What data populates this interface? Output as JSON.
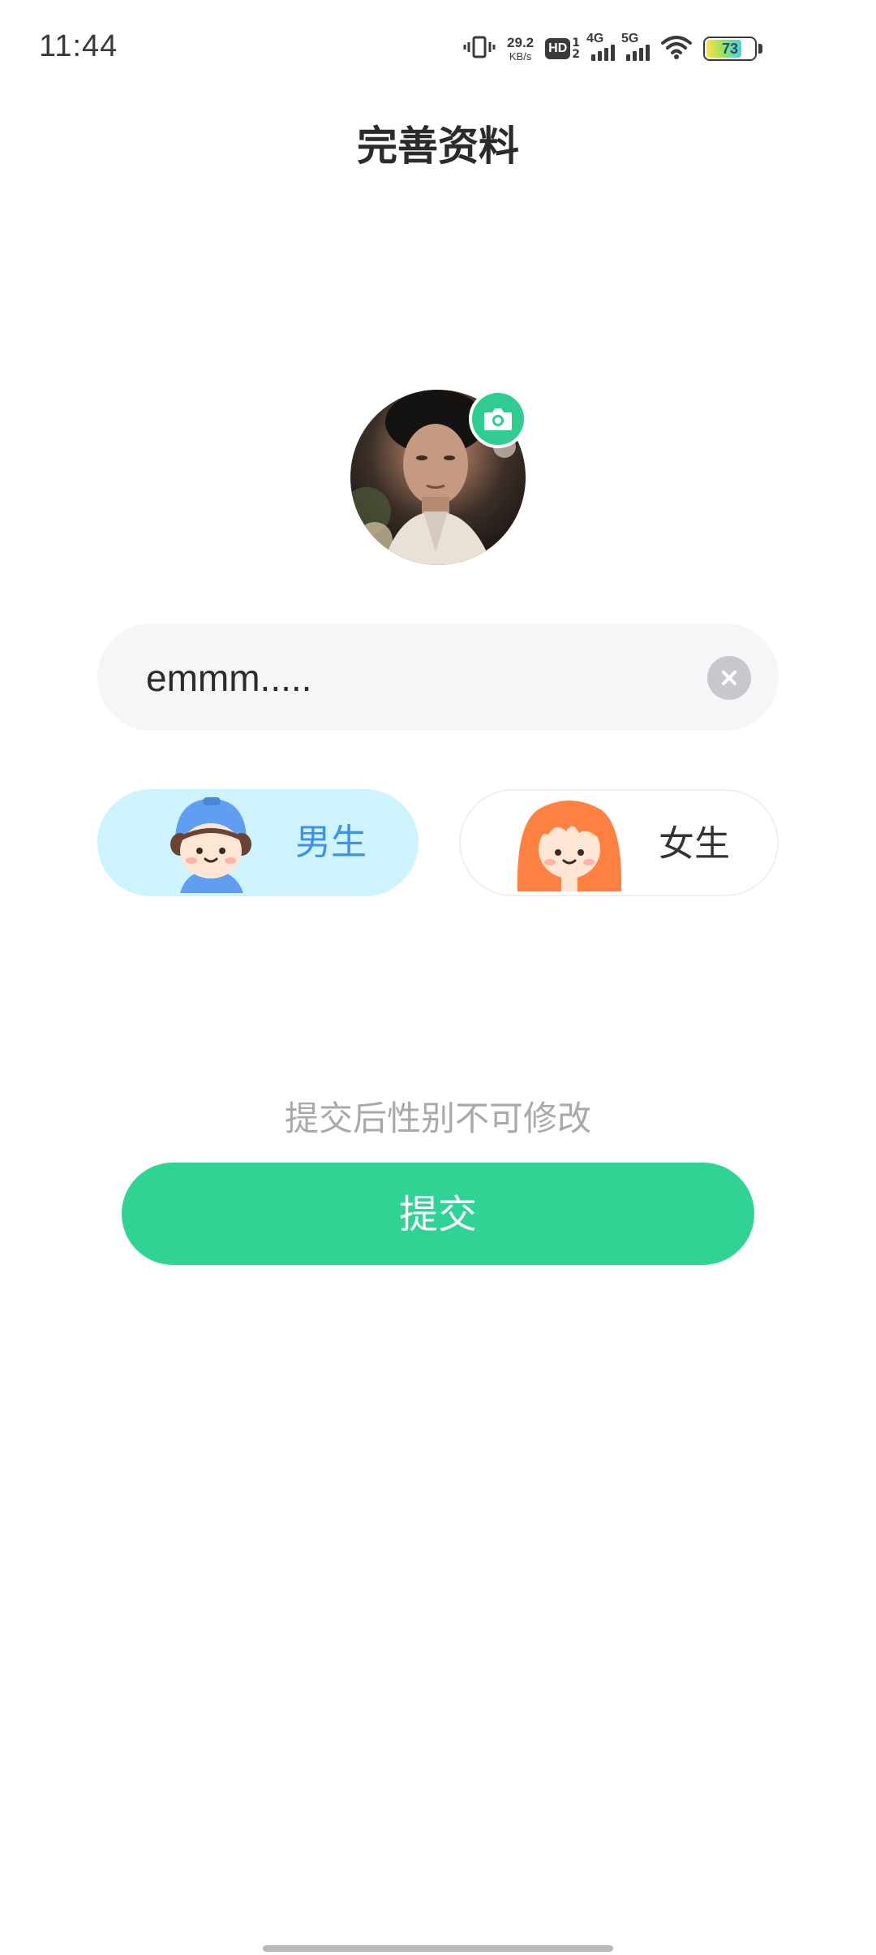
{
  "status_bar": {
    "time": "11:44",
    "net_speed_value": "29.2",
    "net_speed_unit": "KB/s",
    "hd_label": "HD",
    "hd_sub_top": "1",
    "hd_sub_bottom": "2",
    "signal1_label": "4G",
    "signal2_label": "5G",
    "battery_percent": "73",
    "icons": [
      "vibrate-icon",
      "hd-icon",
      "signal-4g-icon",
      "signal-5g-icon",
      "wifi-icon",
      "battery-icon"
    ]
  },
  "header": {
    "title": "完善资料"
  },
  "avatar": {
    "camera_icon": "camera-icon"
  },
  "nickname": {
    "value": "emmm.....",
    "clear_icon": "clear-icon"
  },
  "gender": {
    "options": [
      {
        "label": "男生",
        "selected": true,
        "icon": "boy-avatar-icon"
      },
      {
        "label": "女生",
        "selected": false,
        "icon": "girl-avatar-icon"
      }
    ]
  },
  "hint": "提交后性别不可修改",
  "submit_label": "提交",
  "colors": {
    "accent_green": "#2fd393",
    "male_selected_bg": "#cdf3ff",
    "male_label": "#3f8fec",
    "hint_gray": "#a7a9ac"
  }
}
